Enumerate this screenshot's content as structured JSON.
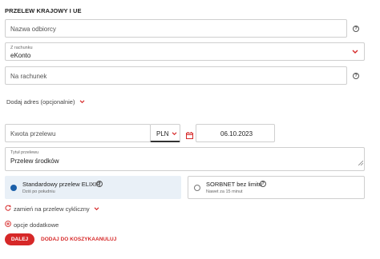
{
  "form": {
    "title": "PRZELEW KRAJOWY I UE",
    "recipient_placeholder": "Nazwa odbiorcy",
    "from_account_label": "Z rachunku",
    "from_account_value": "eKonto",
    "to_account_placeholder": "Na rachunek",
    "add_address_label": "Dodaj adres (opcjonalnie)",
    "amount_placeholder": "Kwota przelewu",
    "currency_value": "PLN",
    "date_value": "06.10.2023",
    "transfer_title_label": "Tytuł przelewu",
    "transfer_title_value": "Przelew środków",
    "help_glyph": "?"
  },
  "options": [
    {
      "title": "Standardowy przelew ELIXIR",
      "subtitle": "Dziś po południu",
      "selected": true
    },
    {
      "title": "SORBNET bez limitu",
      "subtitle": "Nawet za 15 minut",
      "selected": false
    }
  ],
  "links": {
    "cyclic_label": "zamień na przelew cykliczny",
    "additional_label": "opcje dodatkowe"
  },
  "actions": {
    "next_label": "DALEJ",
    "add_to_cart_label": "DODAJ DO KOSZYKA",
    "cancel_label": "ANULUJ"
  },
  "colors": {
    "accent": "#d62828",
    "selected_card_bg": "#e9f0f7",
    "radio_selected": "#1b5fa8"
  },
  "icons": {
    "help": "question-circle-icon",
    "chevron": "chevron-down-icon",
    "calendar": "calendar-icon",
    "cycle": "refresh-icon",
    "add": "plus-circle-icon"
  }
}
